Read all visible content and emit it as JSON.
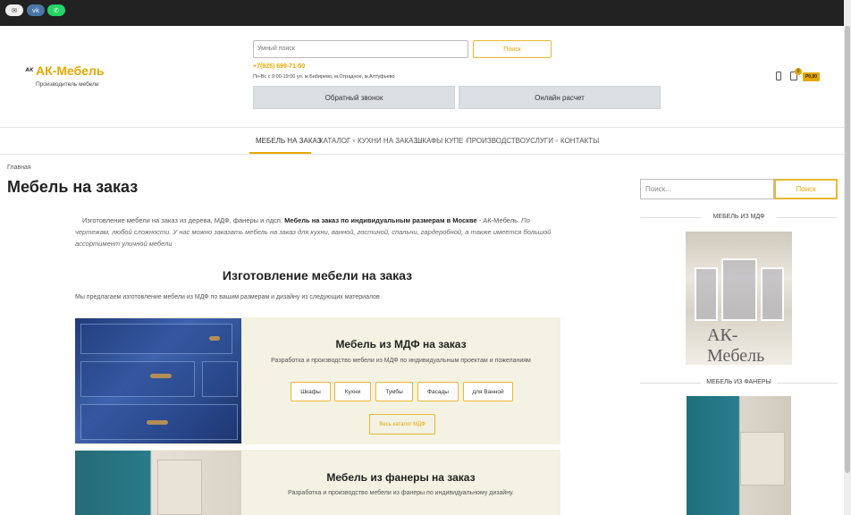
{
  "social": {
    "mail_icon": "mail-icon",
    "vk_label": "vk",
    "whatsapp_icon": "whatsapp-icon"
  },
  "logo": {
    "name": "АК-Мебель",
    "subtitle": "Производитель мебели"
  },
  "header": {
    "search_placeholder": "Умный поиск",
    "search_button": "Поиск",
    "phone": "+7(925) 699-71-50",
    "hours": "Пн-Вс  с 9:00-19:00 ул. м.Бибирево, м.Отрадное, м.Алтуфьево",
    "callback_button": "Обратный звонок",
    "online_calc_button": "Онлайн расчет",
    "cart_count": "0",
    "cart_total": "Р0,00"
  },
  "nav": {
    "items": [
      "МЕБЕЛЬ НА ЗАКАЗ",
      "КАТАЛОГ",
      "КУХНИ НА ЗАКАЗ",
      "ШКАФЫ КУПЕ",
      "ПРОИЗВОДСТВО",
      "УСЛУГИ",
      "КОНТАКТЫ"
    ],
    "active_color": "#e8a800"
  },
  "breadcrumb": "Главная",
  "page_title": "Мебель на заказ",
  "intro": {
    "part1": "Изготовление мебели на заказ из дерева, МДФ, фанеры и лдсп. ",
    "bold": "Мебель на заказ по индивидуальным размерам в Москве",
    "part2": " - АК-Мебель.",
    "italic": "  По чертежам, любой сложности. У нас можно заказать мебель на заказ для кухни, ванной, гостиной, спальни, гардеробной, а также имеется большой ассортимент уличной мебели"
  },
  "section_title": "Изготовление мебели на заказ",
  "offer_text": "Мы предлагаем изготовление мебели из МДФ по вашим размерам и дизайну из следующих материалов",
  "cards": [
    {
      "title": "Мебель из МДФ на заказ",
      "desc": "Разработка и производство мебели из МДФ по индивидуальным проектам и пожеланиям",
      "buttons": [
        "Шкафы",
        "Кухни",
        "Тумбы",
        "Фасады",
        "для Ванной"
      ],
      "all_button": "Весь каталог МДФ"
    },
    {
      "title": "Мебель из фанеры на заказ",
      "desc": "Разработка и производство мебели из фанеры по индивидуальному дизайну."
    }
  ],
  "sidebar": {
    "search_placeholder": "Поиск...",
    "search_button": "Поиск",
    "heading_mdf": "МЕБЕЛЬ ИЗ МДФ",
    "watermark": "АК-Мебель",
    "heading_plywood": "МЕБЕЛЬ ИЗ ФАНЕРЫ"
  },
  "colors": {
    "accent": "#e8a800",
    "card_bg": "#f3f2e3",
    "top_bar": "#222222"
  }
}
